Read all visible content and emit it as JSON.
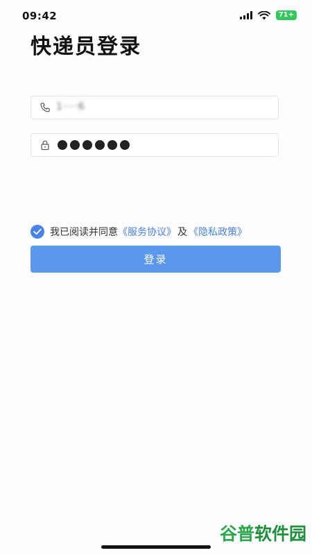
{
  "status_bar": {
    "time": "09:42",
    "battery": "71+"
  },
  "page_title": "快递员登录",
  "phone_field": {
    "value": "1····6"
  },
  "password_field": {
    "masked_value": "●●●●●●"
  },
  "agreement": {
    "prefix": "我已阅读并同意",
    "service_link": "《服务协议》",
    "conjunction": "及",
    "privacy_link": "《隐私政策》",
    "checked": true
  },
  "login_button": {
    "label": "登录"
  },
  "watermark": {
    "part1": "谷普",
    "part2": "软件园"
  },
  "colors": {
    "accent": "#4a83e6",
    "button": "#5b97ed",
    "battery": "#34c759"
  }
}
